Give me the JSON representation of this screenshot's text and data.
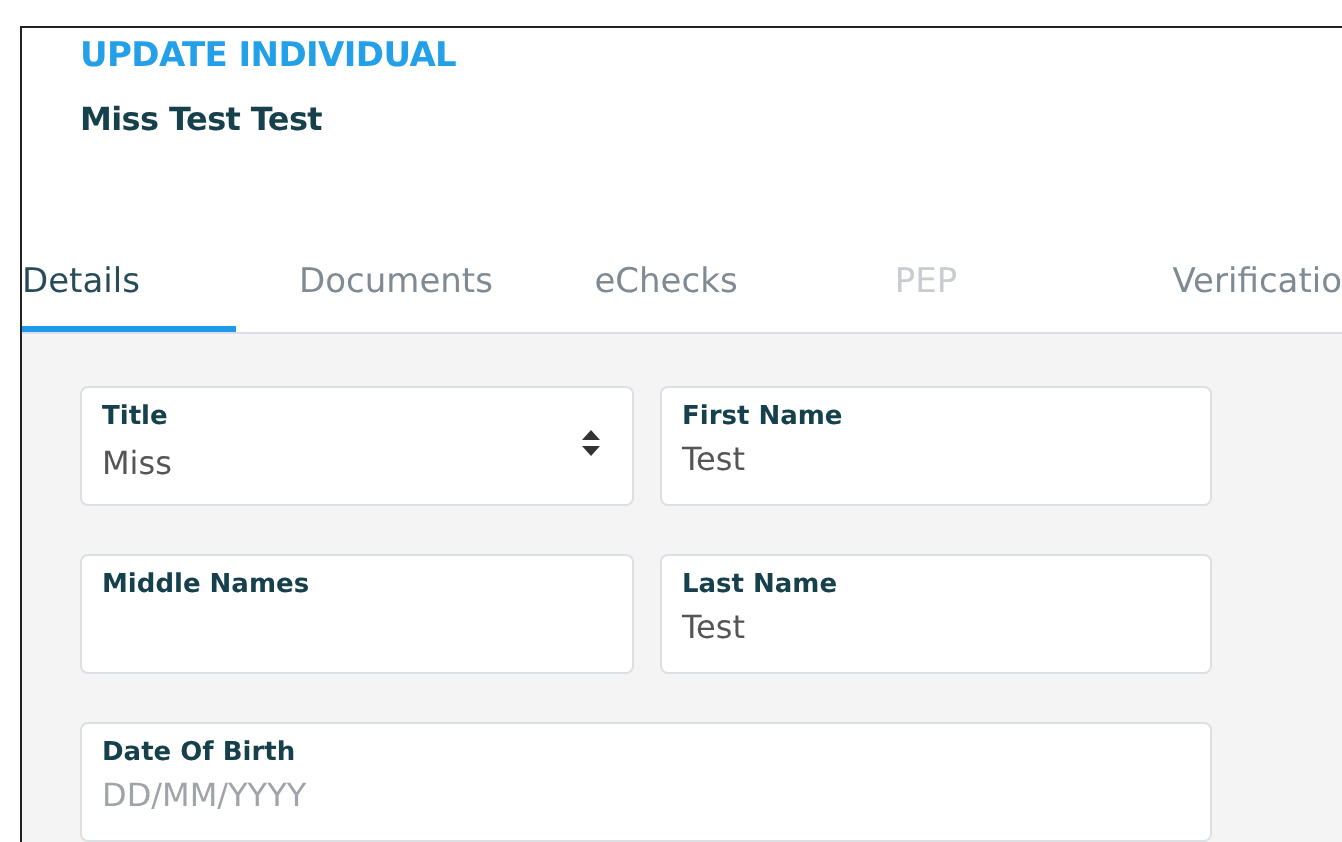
{
  "header": {
    "heading": "UPDATE INDIVIDUAL",
    "name": "Miss Test Test"
  },
  "tabs": [
    {
      "label": "Details",
      "selected": true,
      "disabled": false
    },
    {
      "label": "Documents",
      "selected": false,
      "disabled": false
    },
    {
      "label": "eChecks",
      "selected": false,
      "disabled": false
    },
    {
      "label": "PEP",
      "selected": false,
      "disabled": true
    },
    {
      "label": "Verificatio",
      "selected": false,
      "disabled": false
    }
  ],
  "fields": [
    {
      "kind": "select",
      "label": "Title",
      "value": "Miss"
    },
    {
      "kind": "text",
      "label": "First Name",
      "value": "Test"
    },
    {
      "kind": "text",
      "label": "Middle Names"
    },
    {
      "kind": "text",
      "label": "Last Name",
      "value": "Test"
    },
    {
      "kind": "wide",
      "label": "Date Of Birth",
      "placeholder": "DD/MM/YYYY"
    }
  ]
}
